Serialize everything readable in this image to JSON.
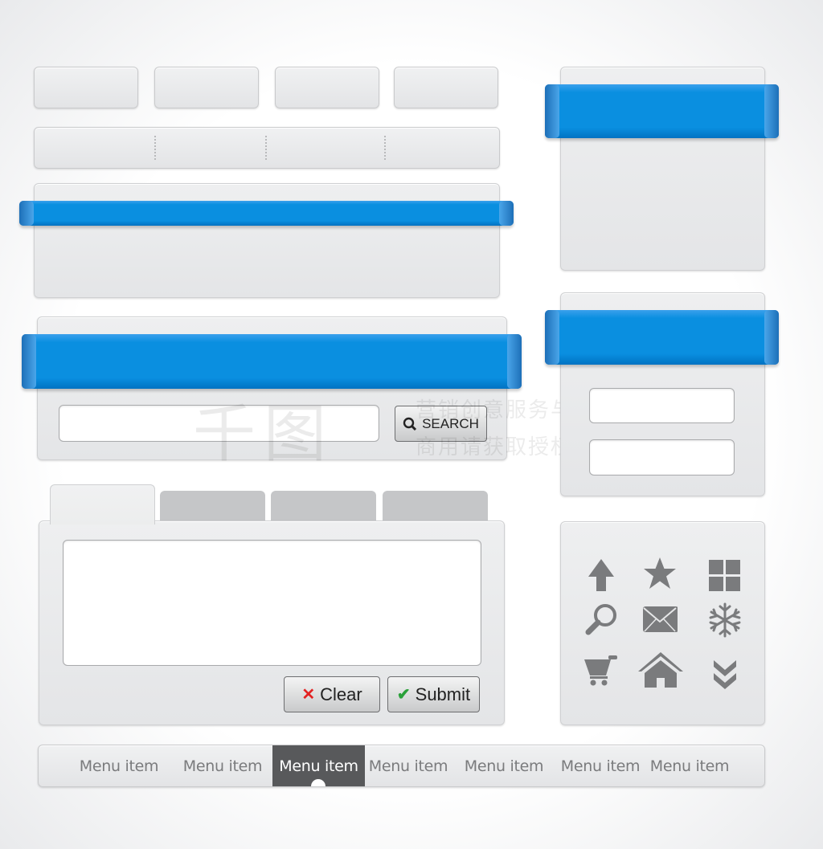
{
  "colors": {
    "ribbon": "#0a8fe0",
    "panel": "#e6e7e8",
    "icon": "#7a7b7d",
    "menu_active": "#58595b",
    "clear_x": "#e32222",
    "submit_check": "#2aa13a"
  },
  "search": {
    "value": "",
    "placeholder": "",
    "button_label": "SEARCH",
    "icon": "search-icon"
  },
  "form": {
    "textarea_value": "",
    "clear_label": "Clear",
    "submit_label": "Submit",
    "clear_icon": "x-icon",
    "submit_icon": "check-icon"
  },
  "login": {
    "field1": "",
    "field2": ""
  },
  "icons": [
    "arrow-up-icon",
    "star-icon",
    "grid-icon",
    "magnifier-icon",
    "mail-icon",
    "snowflake-icon",
    "cart-icon",
    "home-icon",
    "double-chevron-down-icon"
  ],
  "menu": {
    "items": [
      "Menu item",
      "Menu item",
      "Menu item",
      "Menu item",
      "Menu item",
      "Menu item",
      "Menu item"
    ],
    "active_index": 2
  },
  "watermark": {
    "logo": "千图",
    "line1": "营销创意服务与协作平台",
    "line2": "商用请获取授权"
  }
}
